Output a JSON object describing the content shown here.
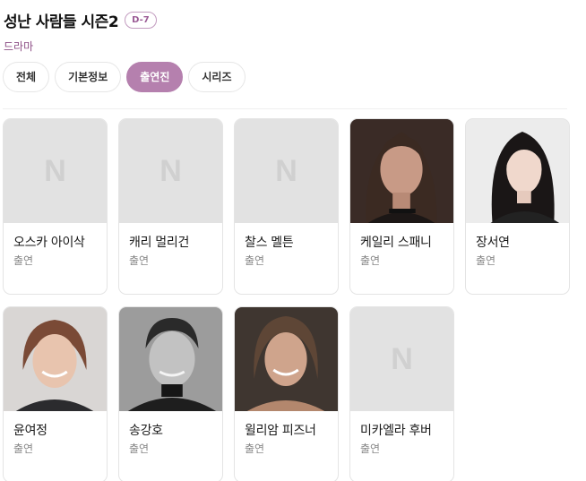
{
  "header": {
    "title": "성난 사람들 시즌2",
    "badge": "D-7",
    "genre": "드라마"
  },
  "tabs": [
    {
      "label": "전체",
      "active": false
    },
    {
      "label": "기본정보",
      "active": false
    },
    {
      "label": "출연진",
      "active": true
    },
    {
      "label": "시리즈",
      "active": false
    }
  ],
  "placeholder_logo": "N",
  "cast": [
    {
      "name": "오스카 아이삭",
      "role": "출연",
      "photo": false
    },
    {
      "name": "캐리 멀리건",
      "role": "출연",
      "photo": false
    },
    {
      "name": "찰스 멜튼",
      "role": "출연",
      "photo": false
    },
    {
      "name": "케일리 스패니",
      "role": "출연",
      "photo": true
    },
    {
      "name": "장서연",
      "role": "출연",
      "photo": true
    },
    {
      "name": "윤여정",
      "role": "출연",
      "photo": true
    },
    {
      "name": "송강호",
      "role": "출연",
      "photo": true
    },
    {
      "name": "윌리암 피즈너",
      "role": "출연",
      "photo": true
    },
    {
      "name": "미카엘라 후버",
      "role": "출연",
      "photo": false
    }
  ],
  "colors": {
    "accent": "#b580ae",
    "genre_text": "#8d4f86",
    "placeholder_bg": "#e2e2e2"
  }
}
